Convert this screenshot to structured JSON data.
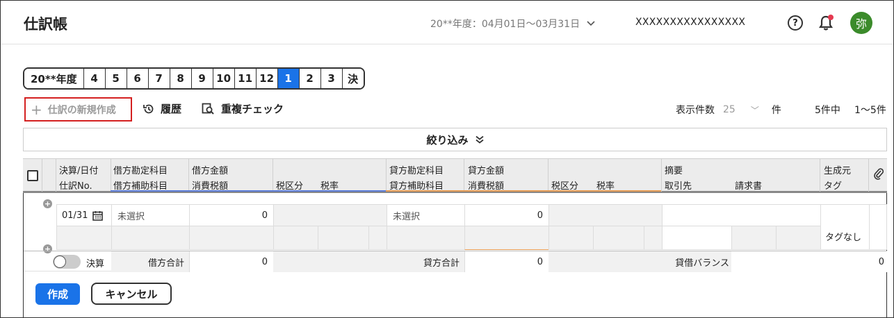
{
  "header": {
    "title": "仕訳帳",
    "fiscal_year": "20**年度：04月01日〜03月31日",
    "company": "XXXXXXXXXXXXXXXX",
    "avatar_text": "弥",
    "avatar_color": "#3b8b2b",
    "notification_dot_color": "#e53950"
  },
  "month_tabs": [
    {
      "label": "20**年度",
      "active": false
    },
    {
      "label": "4",
      "active": false
    },
    {
      "label": "5",
      "active": false
    },
    {
      "label": "6",
      "active": false
    },
    {
      "label": "7",
      "active": false
    },
    {
      "label": "8",
      "active": false
    },
    {
      "label": "9",
      "active": false
    },
    {
      "label": "10",
      "active": false
    },
    {
      "label": "11",
      "active": false
    },
    {
      "label": "12",
      "active": false
    },
    {
      "label": "1",
      "active": true
    },
    {
      "label": "2",
      "active": false
    },
    {
      "label": "3",
      "active": false
    },
    {
      "label": "決",
      "active": false
    }
  ],
  "toolbar": {
    "new_entry": "仕訳の新規作成",
    "history": "履歴",
    "duplicate_check": "重複チェック",
    "per_page_label": "表示件数",
    "per_page_value": "25",
    "per_page_unit": "件",
    "total_count": "5件中",
    "range": "1〜5件"
  },
  "filter": {
    "label": "絞り込み"
  },
  "table_header": {
    "row1": {
      "date": "決算/日付",
      "debit_account": "借方勘定科目",
      "debit_amount": "借方金額",
      "credit_account": "貸方勘定科目",
      "credit_amount": "貸方金額",
      "summary": "摘要",
      "source": "生成元"
    },
    "row2": {
      "entry_no": "仕訳No.",
      "debit_sub": "借方補助科目",
      "debit_tax": "消費税額",
      "debit_tax_cat": "税区分",
      "debit_tax_rate": "税率",
      "credit_sub": "貸方補助科目",
      "credit_tax": "消費税額",
      "credit_tax_cat": "税区分",
      "credit_tax_rate": "税率",
      "partner": "取引先",
      "invoice": "請求書",
      "tag": "タグ"
    }
  },
  "entry": {
    "date": "01/31",
    "debit_account": "未選択",
    "debit_amount": "0",
    "credit_account": "未選択",
    "credit_amount": "0",
    "tag": "タグなし"
  },
  "totals": {
    "closing_label": "決算",
    "debit_total_label": "借方合計",
    "debit_total": "0",
    "credit_total_label": "貸方合計",
    "credit_total": "0",
    "balance_label": "貸借バランス",
    "balance": "0"
  },
  "actions": {
    "create": "作成",
    "cancel": "キャンセル"
  },
  "colors": {
    "accent": "#1a73e8",
    "highlight_border": "#d42020",
    "debit_underline": "#5a7bd8",
    "credit_underline": "#e59a52"
  }
}
